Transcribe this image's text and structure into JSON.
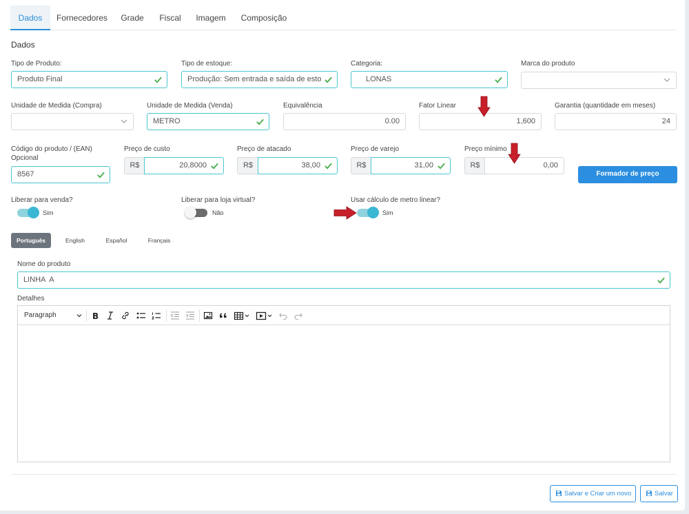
{
  "tabs": [
    {
      "label": "Dados",
      "active": true
    },
    {
      "label": "Fornecedores"
    },
    {
      "label": "Grade"
    },
    {
      "label": "Fiscal"
    },
    {
      "label": "Imagem"
    },
    {
      "label": "Composição"
    }
  ],
  "section_title": "Dados",
  "fields": {
    "tipo_produto": {
      "label": "Tipo de Produto:",
      "value": "Produto Final"
    },
    "tipo_estoque": {
      "label": "Tipo de estoque:",
      "value": "Produção: Sem entrada e saída de estoque"
    },
    "categoria": {
      "label": "Categoria:",
      "value": "LONAS"
    },
    "marca": {
      "label": "Marca do produto",
      "value": ""
    },
    "unidade_compra": {
      "label": "Unidade de Medida (Compra)",
      "value": ""
    },
    "unidade_venda": {
      "label": "Unidade de Medida (Venda)",
      "value": "METRO"
    },
    "equivalencia": {
      "label": "Equivalência",
      "value": "0.00"
    },
    "fator_linear": {
      "label": "Fator Linear",
      "value": "1,600"
    },
    "garantia": {
      "label": "Garantia (quantidade em meses)",
      "value": "24"
    },
    "codigo": {
      "label": "Código do produto / (EAN)",
      "sublabel": "Opcional",
      "value": "8567"
    },
    "preco_custo": {
      "label": "Preço de custo",
      "currency": "R$",
      "value": "20,8000"
    },
    "preco_atacado": {
      "label": "Preço de atacado",
      "currency": "R$",
      "value": "38,00"
    },
    "preco_varejo": {
      "label": "Preço de varejo",
      "currency": "R$",
      "value": "31,00"
    },
    "preco_minimo": {
      "label": "Preço mínimo",
      "currency": "R$",
      "value": "0,00"
    }
  },
  "formador_button": "Formador de preço",
  "toggles": {
    "venda": {
      "label": "Liberar para venda?",
      "state": "Sim",
      "on": true
    },
    "loja": {
      "label": "Liberar para loja virtual?",
      "state": "Não",
      "on": false
    },
    "metro": {
      "label": "Usar cálculo de metro linear?",
      "state": "Sim",
      "on": true
    }
  },
  "languages": [
    {
      "label": "Português",
      "active": true
    },
    {
      "label": "English"
    },
    {
      "label": "Español"
    },
    {
      "label": "Français"
    }
  ],
  "nome_produto": {
    "label": "Nome do produto",
    "value": "LINHA  A"
  },
  "detalhes": {
    "label": "Detalhes"
  },
  "editor": {
    "paragraph": "Paragraph"
  },
  "footer": {
    "save_new": "Salvar e Criar um novo",
    "save": "Salvar"
  },
  "colors": {
    "accent": "#2b8ee0",
    "valid_border": "#48c6cf",
    "check": "#4caf50",
    "arrow": "#c8202b",
    "toggle_on": "#3bb7d3"
  }
}
